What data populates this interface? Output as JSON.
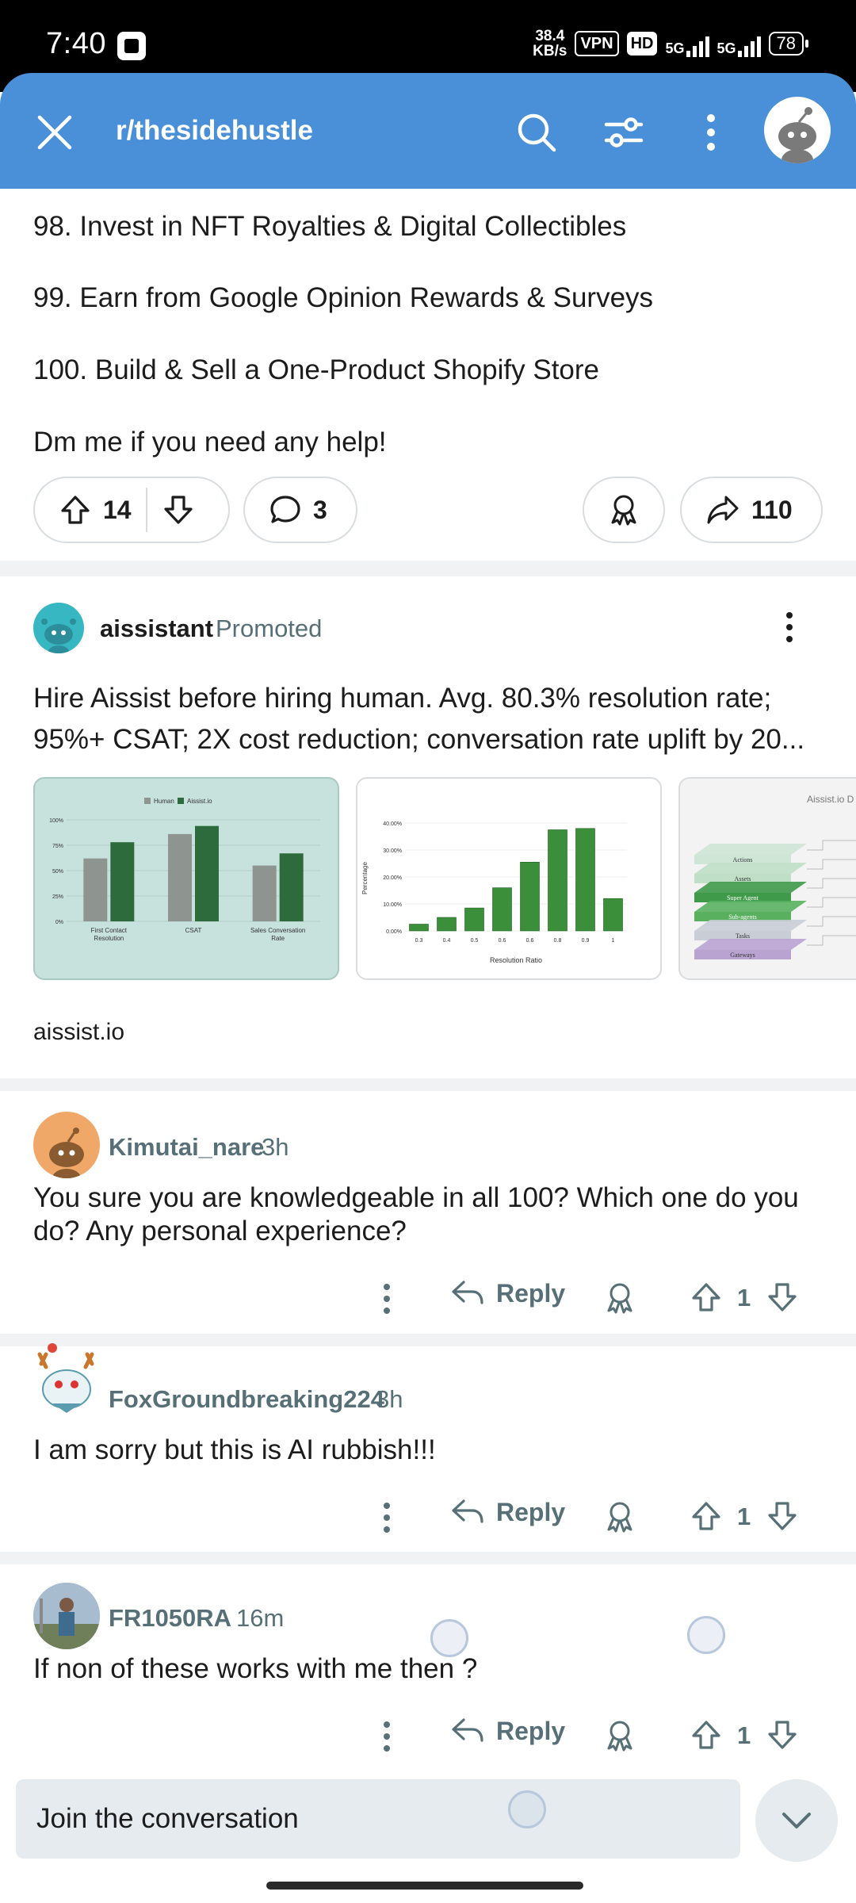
{
  "status_bar": {
    "time": "7:40",
    "net_speed_top": "38.4",
    "net_speed_bottom": "KB/s",
    "vpn": "VPN",
    "hd": "HD",
    "signal1": "5G",
    "signal2": "5G",
    "battery": "78"
  },
  "header": {
    "title": "r/thesidehustle",
    "icons": [
      "close-icon",
      "search-icon",
      "filter-icon",
      "more-vertical-icon",
      "avatar"
    ]
  },
  "post": {
    "lines": [
      "98. Invest in NFT Royalties & Digital Collectibles",
      "99. Earn from Google Opinion Rewards & Surveys",
      "100. Build & Sell a One-Product Shopify Store",
      "Dm me if you need any help!"
    ],
    "upvotes": "14",
    "comments": "3",
    "shares": "110"
  },
  "promoted": {
    "author": "aissistant",
    "tag": "Promoted",
    "body_line1": "Hire Aissist before hiring human. Avg. 80.3% resolution rate;",
    "body_line2": "95%+ CSAT; 2X cost reduction; conversation rate uplift by 20...",
    "domain": "aissist.io",
    "chart1": {
      "legend_human": "Human",
      "legend_aissist": "Aissist.io",
      "ticks": [
        "100%",
        "75%",
        "50%",
        "25%",
        "0%"
      ],
      "categories": [
        "First Contact Resolution",
        "CSAT",
        "Sales Conversation Rate"
      ],
      "human": [
        0.62,
        0.86,
        0.55
      ],
      "aissist": [
        0.78,
        0.94,
        0.67
      ],
      "color_human": "#8e9590",
      "color_aissist": "#2e6b3c"
    },
    "chart2": {
      "ylabel": "Percentage",
      "xlabel": "Resolution Ratio",
      "ticks": [
        "40.00%",
        "30.00%",
        "20.00%",
        "10.00%",
        "0.00%"
      ],
      "categories": [
        "0.3",
        "0.4",
        "0.5",
        "0.6",
        "0.6",
        "0.8",
        "0.9",
        "1"
      ],
      "values": [
        2.5,
        5,
        8.5,
        16,
        25.5,
        37.5,
        38,
        12
      ],
      "ymax": 40,
      "color": "#3b8f3b"
    },
    "chart3": {
      "title": "Aissist.io D",
      "layers": [
        "Actions",
        "Assets",
        "Super Agent",
        "Sub-agents",
        "Tasks",
        "Gateways"
      ]
    }
  },
  "comments": [
    {
      "user": "Kimutai_nare",
      "time": "3h",
      "body_line1": "You sure you are knowledgeable in all 100? Which one do you",
      "body_line2": "do? Any personal experience?",
      "reply": "Reply",
      "votes": "1"
    },
    {
      "user": "FoxGroundbreaking224",
      "time": "3h",
      "body_line1": "I am sorry but this is AI rubbish!!!",
      "reply": "Reply",
      "votes": "1"
    },
    {
      "user": "FR1050RA",
      "time": "16m",
      "body_line1": "If non of these works with me then ?",
      "reply": "Reply",
      "votes": "1"
    }
  ],
  "composer": {
    "placeholder": "Join the conversation"
  },
  "colors": {
    "header": "#4a90d9",
    "meta_text": "#576f76",
    "pill_border": "#d9dde0"
  }
}
